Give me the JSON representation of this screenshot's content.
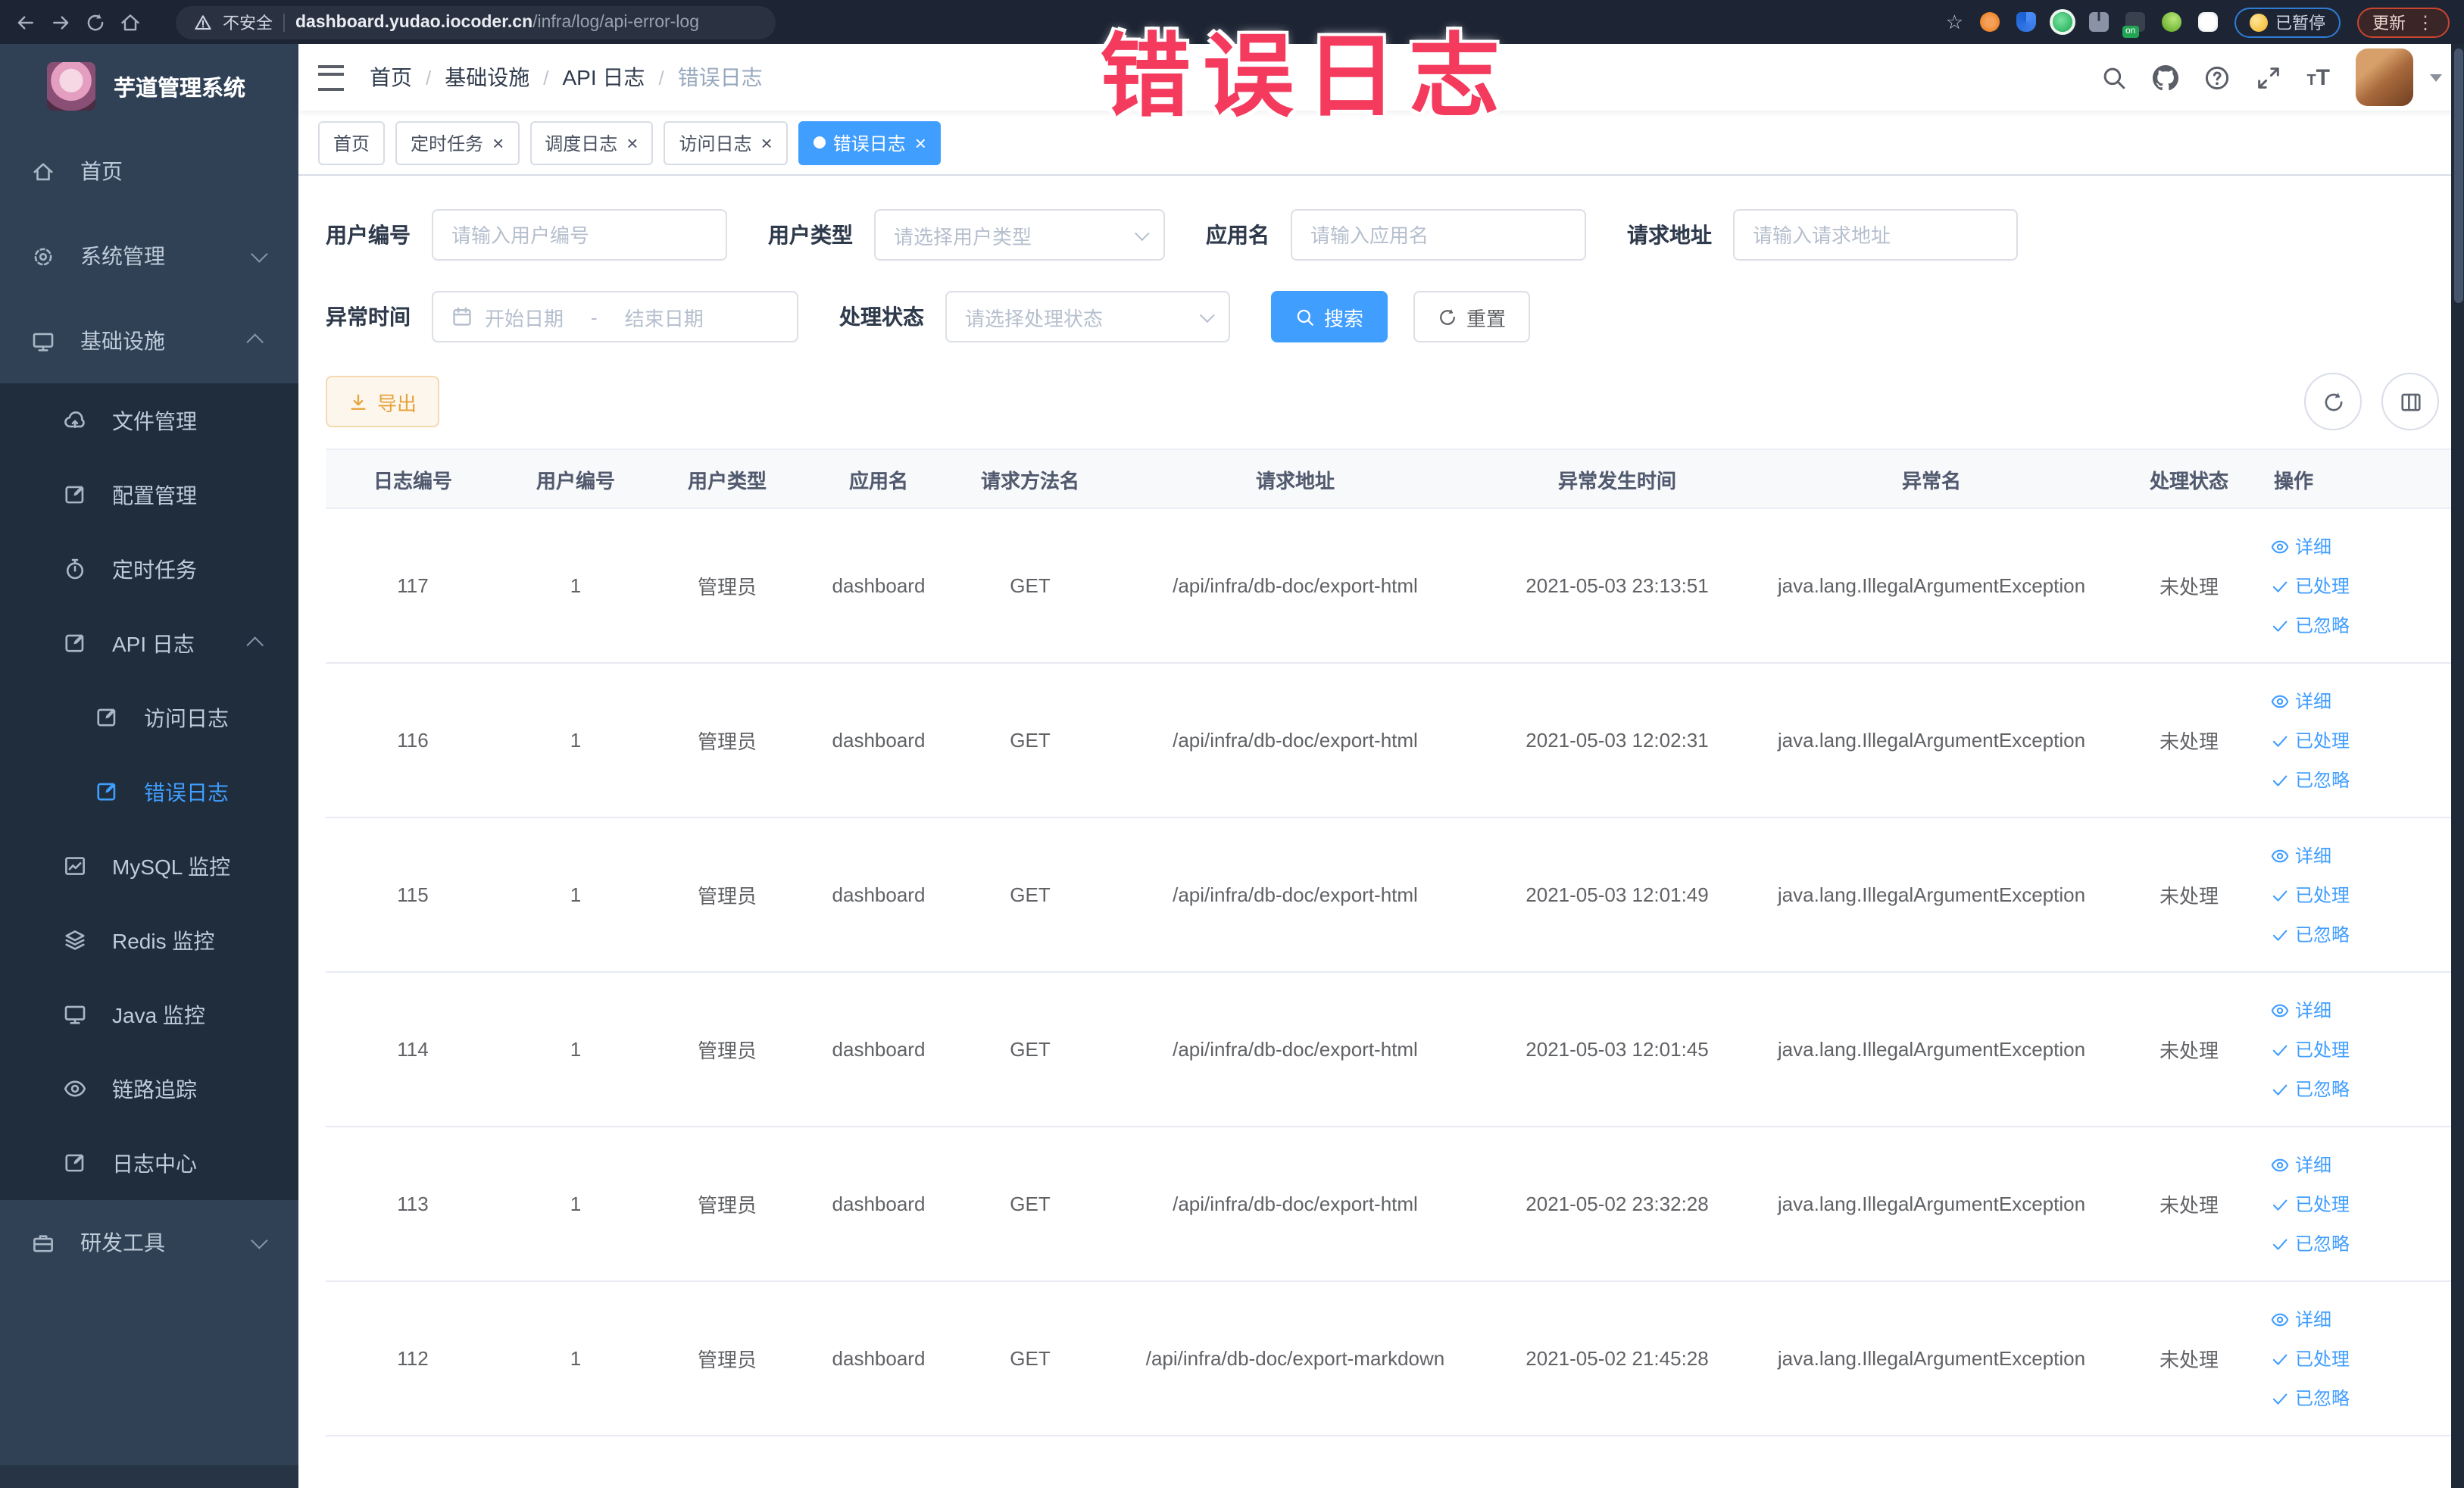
{
  "colors": {
    "accent": "#409eff",
    "warning": "#e6a23c",
    "annotation": "#f43b5e",
    "sidebar_bg": "#304156",
    "submenu_bg": "#1f2d3d"
  },
  "annotation": {
    "text": "错误日志"
  },
  "browser": {
    "security_label": "不安全",
    "url_domain": "dashboard.yudao.iocoder.cn",
    "url_path": "/infra/log/api-error-log",
    "paused_badge": "已暂停",
    "update_button": "更新",
    "menu_dots": "⋮",
    "bookmark_star": "☆"
  },
  "sidebar": {
    "logo_title": "芋道管理系统",
    "items": [
      {
        "name": "home",
        "label": "首页",
        "level": 1,
        "icon": "home"
      },
      {
        "name": "system-management",
        "label": "系统管理",
        "level": 1,
        "icon": "gear",
        "chevron": "down"
      },
      {
        "name": "infrastructure",
        "label": "基础设施",
        "level": 1,
        "icon": "monitor",
        "chevron": "up"
      },
      {
        "name": "file-management",
        "label": "文件管理",
        "level": 2,
        "icon": "cloud"
      },
      {
        "name": "config-management",
        "label": "配置管理",
        "level": 2,
        "icon": "logdoc"
      },
      {
        "name": "scheduled-jobs",
        "label": "定时任务",
        "level": 2,
        "icon": "timer"
      },
      {
        "name": "api-logs",
        "label": "API 日志",
        "level": 2,
        "icon": "logdoc",
        "chevron": "up"
      },
      {
        "name": "access-log",
        "label": "访问日志",
        "level": 3,
        "icon": "logdoc"
      },
      {
        "name": "error-log",
        "label": "错误日志",
        "level": 3,
        "icon": "logdoc",
        "active": true
      },
      {
        "name": "mysql-monitor",
        "label": "MySQL 监控",
        "level": 2,
        "icon": "chart"
      },
      {
        "name": "redis-monitor",
        "label": "Redis 监控",
        "level": 2,
        "icon": "layers"
      },
      {
        "name": "java-monitor",
        "label": "Java 监控",
        "level": 2,
        "icon": "monitor"
      },
      {
        "name": "trace",
        "label": "链路追踪",
        "level": 2,
        "icon": "eye"
      },
      {
        "name": "log-center",
        "label": "日志中心",
        "level": 2,
        "icon": "logdoc"
      },
      {
        "name": "dev-tools",
        "label": "研发工具",
        "level": 1,
        "icon": "tools",
        "chevron": "down"
      }
    ]
  },
  "navbar": {
    "breadcrumb": [
      "首页",
      "基础设施",
      "API 日志",
      "错误日志"
    ]
  },
  "tabs": [
    {
      "name": "home",
      "label": "首页",
      "closable": false,
      "active": false
    },
    {
      "name": "scheduled-jobs",
      "label": "定时任务",
      "closable": true,
      "active": false
    },
    {
      "name": "schedule-log",
      "label": "调度日志",
      "closable": true,
      "active": false
    },
    {
      "name": "access-log",
      "label": "访问日志",
      "closable": true,
      "active": false
    },
    {
      "name": "error-log",
      "label": "错误日志",
      "closable": true,
      "active": true
    }
  ],
  "filters": {
    "user_id": {
      "label": "用户编号",
      "placeholder": "请输入用户编号"
    },
    "user_type": {
      "label": "用户类型",
      "placeholder": "请选择用户类型"
    },
    "app_name": {
      "label": "应用名",
      "placeholder": "请输入应用名"
    },
    "request_url": {
      "label": "请求地址",
      "placeholder": "请输入请求地址"
    },
    "exception_time": {
      "label": "异常时间",
      "start_placeholder": "开始日期",
      "separator": "-",
      "end_placeholder": "结束日期"
    },
    "process_status": {
      "label": "处理状态",
      "placeholder": "请选择处理状态"
    },
    "search_button": "搜索",
    "reset_button": "重置"
  },
  "toolbar": {
    "export_button": "导出"
  },
  "table": {
    "columns": [
      "日志编号",
      "用户编号",
      "用户类型",
      "应用名",
      "请求方法名",
      "请求地址",
      "异常发生时间",
      "异常名",
      "处理状态",
      "操作"
    ],
    "actions": [
      "详细",
      "已处理",
      "已忽略"
    ],
    "rows": [
      {
        "id": "117",
        "user_id": "1",
        "user_type": "管理员",
        "app": "dashboard",
        "method": "GET",
        "url": "/api/infra/db-doc/export-html",
        "time": "2021-05-03 23:13:51",
        "exception": "java.lang.IllegalArgumentException",
        "status": "未处理"
      },
      {
        "id": "116",
        "user_id": "1",
        "user_type": "管理员",
        "app": "dashboard",
        "method": "GET",
        "url": "/api/infra/db-doc/export-html",
        "time": "2021-05-03 12:02:31",
        "exception": "java.lang.IllegalArgumentException",
        "status": "未处理"
      },
      {
        "id": "115",
        "user_id": "1",
        "user_type": "管理员",
        "app": "dashboard",
        "method": "GET",
        "url": "/api/infra/db-doc/export-html",
        "time": "2021-05-03 12:01:49",
        "exception": "java.lang.IllegalArgumentException",
        "status": "未处理"
      },
      {
        "id": "114",
        "user_id": "1",
        "user_type": "管理员",
        "app": "dashboard",
        "method": "GET",
        "url": "/api/infra/db-doc/export-html",
        "time": "2021-05-03 12:01:45",
        "exception": "java.lang.IllegalArgumentException",
        "status": "未处理"
      },
      {
        "id": "113",
        "user_id": "1",
        "user_type": "管理员",
        "app": "dashboard",
        "method": "GET",
        "url": "/api/infra/db-doc/export-html",
        "time": "2021-05-02 23:32:28",
        "exception": "java.lang.IllegalArgumentException",
        "status": "未处理"
      },
      {
        "id": "112",
        "user_id": "1",
        "user_type": "管理员",
        "app": "dashboard",
        "method": "GET",
        "url": "/api/infra/db-doc/export-markdown",
        "time": "2021-05-02 21:45:28",
        "exception": "java.lang.IllegalArgumentException",
        "status": "未处理"
      }
    ]
  }
}
